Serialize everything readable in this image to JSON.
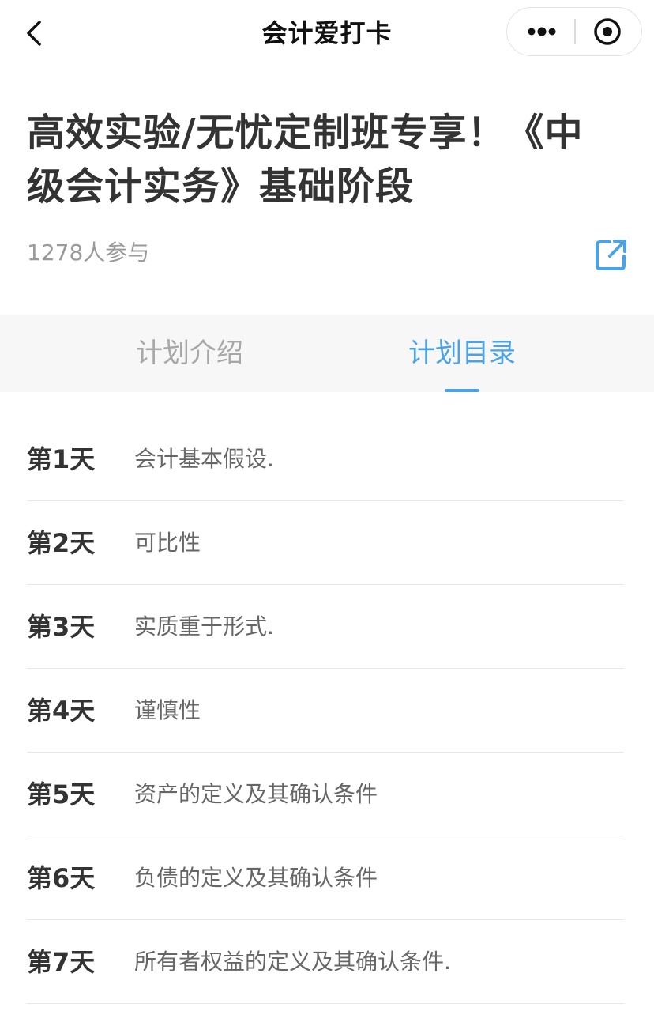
{
  "navbar": {
    "title": "会计爱打卡",
    "back_icon": "chevron-left-icon",
    "more_icon": "more-dots-icon",
    "close_icon": "target-close-icon"
  },
  "plan": {
    "title": "高效实验/无忧定制班专享！《中级会计实务》基础阶段",
    "participants": "1278人参与",
    "share_icon": "share-external-icon"
  },
  "tabs": [
    {
      "label": "计划介绍",
      "active": false
    },
    {
      "label": "计划目录",
      "active": true
    }
  ],
  "colors": {
    "accent": "#4aa3e4",
    "title_text": "#333333",
    "muted_text": "#9a9a9a"
  },
  "catalog": [
    {
      "day": "第1天",
      "topic": "会计基本假设."
    },
    {
      "day": "第2天",
      "topic": "可比性"
    },
    {
      "day": "第3天",
      "topic": "实质重于形式."
    },
    {
      "day": "第4天",
      "topic": "谨慎性"
    },
    {
      "day": "第5天",
      "topic": "资产的定义及其确认条件"
    },
    {
      "day": "第6天",
      "topic": "负债的定义及其确认条件"
    },
    {
      "day": "第7天",
      "topic": "所有者权益的定义及其确认条件."
    }
  ]
}
